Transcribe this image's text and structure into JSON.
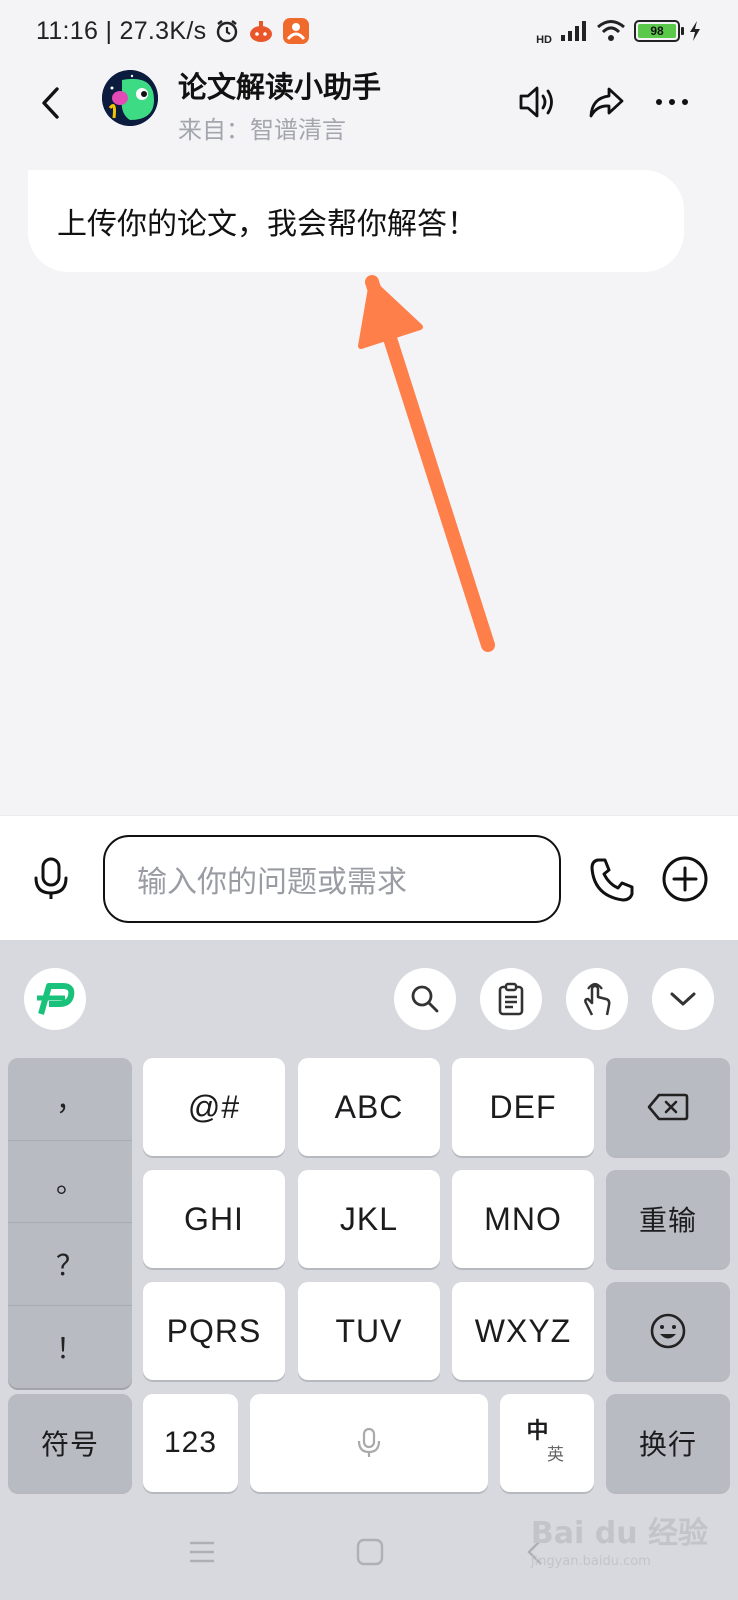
{
  "status_bar": {
    "time": "11:16 | 27.3K/s",
    "battery": "98",
    "network": "HD"
  },
  "header": {
    "title": "论文解读小助手",
    "subtitle": "来自：智谱清言"
  },
  "chat": {
    "messages": [
      {
        "from": "bot",
        "text": "上传你的论文，我会帮你解答！"
      }
    ],
    "annotation_color": "#ff7f4a"
  },
  "input": {
    "placeholder": "输入你的问题或需求"
  },
  "keyboard": {
    "punctuation": [
      "，",
      "。",
      "？",
      "！"
    ],
    "row1": [
      "@#",
      "ABC",
      "DEF"
    ],
    "row2": [
      "GHI",
      "JKL",
      "MNO"
    ],
    "row2_right": "重输",
    "row3": [
      "PQRS",
      "TUV",
      "WXYZ"
    ],
    "bottom": {
      "symbols": "符号",
      "numbers": "123",
      "lang_main": "中",
      "lang_sub": "英",
      "enter": "换行"
    }
  },
  "watermark": {
    "brand": "Bai du 经验",
    "url": "jingyan.baidu.com"
  }
}
